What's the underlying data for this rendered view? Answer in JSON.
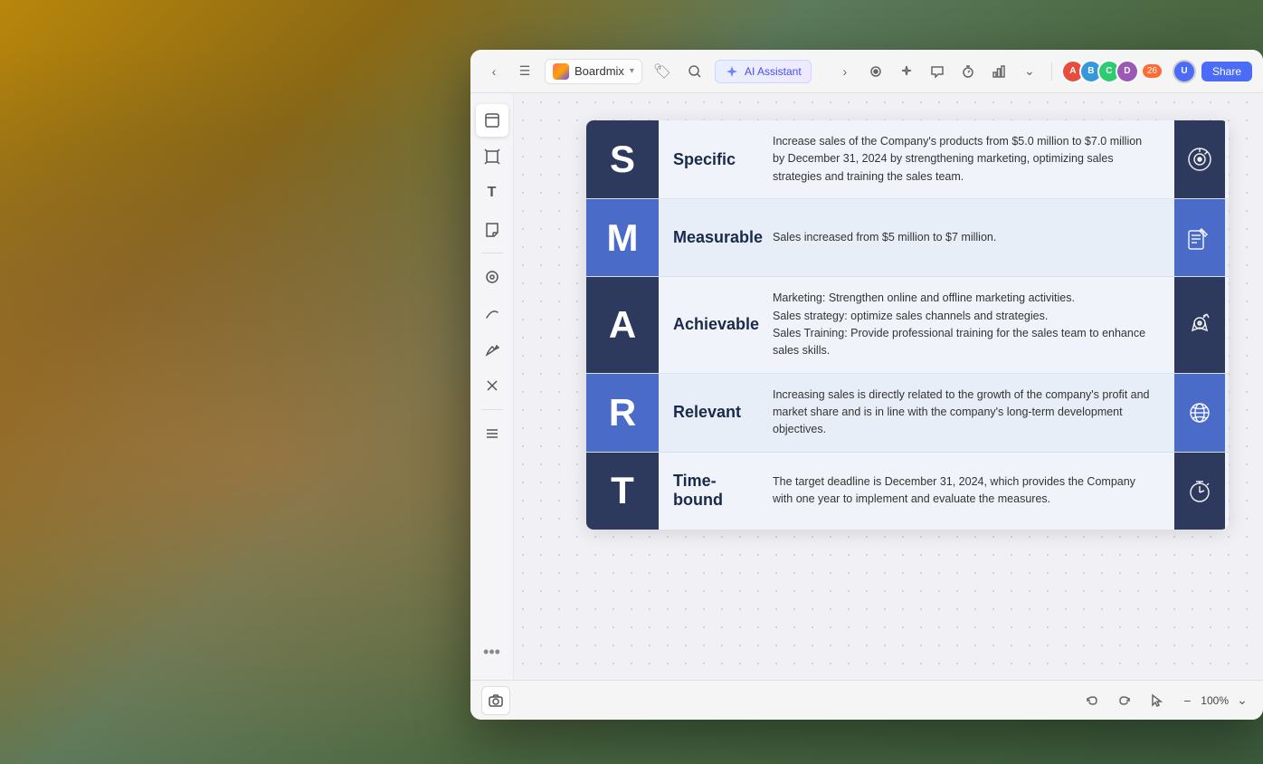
{
  "background": {
    "color": "#7a6040"
  },
  "toolbar": {
    "back_label": "‹",
    "menu_label": "☰",
    "boardmix_label": "Boardmix",
    "tag_label": "🏷",
    "search_label": "🔍",
    "ai_label": "AI Assistant",
    "expand_label": "›",
    "icons": [
      "⏺",
      "✦",
      "💬",
      "⏱",
      "📊",
      "⌄"
    ],
    "avatar_count": "26",
    "share_label": "Share"
  },
  "sidebar": {
    "items": [
      {
        "icon": "◫",
        "name": "template",
        "label": "Template"
      },
      {
        "icon": "⊞",
        "name": "frame",
        "label": "Frame"
      },
      {
        "icon": "T",
        "name": "text",
        "label": "Text"
      },
      {
        "icon": "◧",
        "name": "sticky",
        "label": "Sticky Note"
      },
      {
        "icon": "◎",
        "name": "component",
        "label": "Component"
      },
      {
        "icon": "∿",
        "name": "line",
        "label": "Line"
      },
      {
        "icon": "⌇",
        "name": "pen",
        "label": "Pen"
      },
      {
        "icon": "✕",
        "name": "plugin",
        "label": "Plugin"
      },
      {
        "icon": "≡",
        "name": "list",
        "label": "List"
      }
    ],
    "more": "•••"
  },
  "smart_table": {
    "rows": [
      {
        "letter": "S",
        "letter_style": "dark",
        "label": "Specific",
        "description": "Increase sales of the Company's products from $5.0 million to $7.0 million by December 31, 2024 by strengthening marketing, optimizing sales strategies and training the sales team.",
        "icon_type": "target",
        "icon_style": "dark",
        "row_style": "dark-bg"
      },
      {
        "letter": "M",
        "letter_style": "medium",
        "label": "Measurable",
        "description": "Sales increased from $5 million to $7 million.",
        "icon_type": "ruler",
        "icon_style": "medium",
        "row_style": "light-bg"
      },
      {
        "letter": "A",
        "letter_style": "dark",
        "label": "Achievable",
        "description": "Marketing: Strengthen online and offline marketing activities.\nSales strategy: optimize sales channels and strategies.\nSales Training: Provide professional training for the sales team to enhance sales skills.",
        "icon_type": "gear",
        "icon_style": "dark",
        "row_style": "dark-bg"
      },
      {
        "letter": "R",
        "letter_style": "medium",
        "label": "Relevant",
        "description": "Increasing sales is directly related to the growth of the company's profit and market share and is in line with the company's long-term development objectives.",
        "icon_type": "atom",
        "icon_style": "medium",
        "row_style": "light-bg"
      },
      {
        "letter": "T",
        "letter_style": "dark",
        "label": "Time-bound",
        "description": "The target deadline is December 31, 2024, which provides the Company with one year to implement and evaluate the measures.",
        "icon_type": "clock",
        "icon_style": "dark",
        "row_style": "dark-bg"
      }
    ]
  },
  "bottom_toolbar": {
    "undo_label": "↩",
    "redo_label": "↪",
    "cursor_label": "↖",
    "zoom_minus_label": "−",
    "zoom_value": "100%",
    "zoom_expand_label": "⌄"
  },
  "avatars": [
    {
      "color": "#e74c3c",
      "initials": "A"
    },
    {
      "color": "#3498db",
      "initials": "B"
    },
    {
      "color": "#2ecc71",
      "initials": "C"
    },
    {
      "color": "#9b59b6",
      "initials": "D"
    }
  ]
}
